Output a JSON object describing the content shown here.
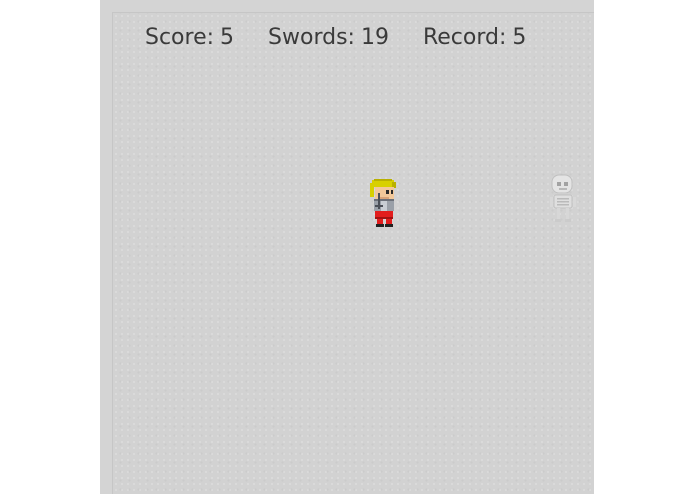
{
  "hud": {
    "score_label": "Score:",
    "score_value": "5",
    "swords_label": "Swords:",
    "swords_value": "19",
    "record_label": "Record:",
    "record_value": "5"
  },
  "sprites": {
    "hero": "hero-knight-sprite",
    "enemy": "skeleton-ghost-sprite"
  },
  "colors": {
    "background": "#d2d2d2",
    "hud_text": "#3a3a3a",
    "hero_hair": "#d8d000",
    "hero_body": "#e21d1d",
    "hero_armor": "#9aa0a8",
    "skeleton": "#e8e8e8"
  }
}
